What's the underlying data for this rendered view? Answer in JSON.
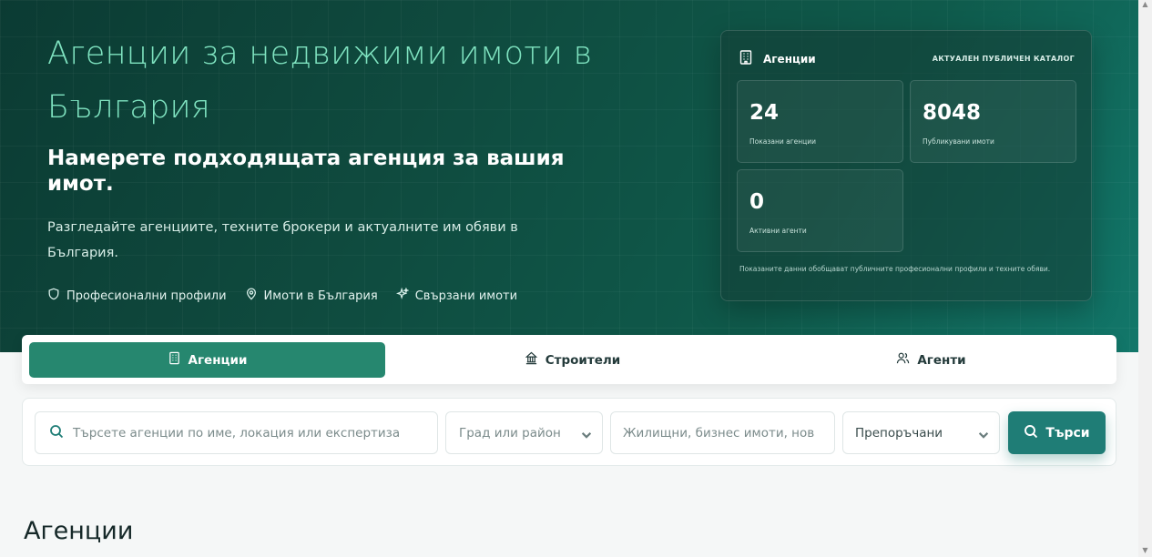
{
  "hero": {
    "title": "Агенции за недвижими имоти в България",
    "subtitle": "Намерете подходящата агенция за вашия имот.",
    "description": "Разгледайте агенциите, техните брокери и актуалните им обяви в България.",
    "features": [
      {
        "icon": "shield-icon",
        "label": "Професионални профили"
      },
      {
        "icon": "location-pin-icon",
        "label": "Имоти в България"
      },
      {
        "icon": "sparkles-icon",
        "label": "Свързани имоти"
      }
    ]
  },
  "stats": {
    "title": "Агенции",
    "catalog": "АКТУАЛЕН ПУБЛИЧЕН КАТАЛОГ",
    "cards": [
      {
        "value": "24",
        "label": "Показани агенции"
      },
      {
        "value": "8048",
        "label": "Публикувани имоти"
      },
      {
        "value": "0",
        "label": "Активни агенти"
      }
    ],
    "note": "Показаните данни обобщават публичните професионални профили и техните обяви."
  },
  "tabs": [
    {
      "label": "Агенции",
      "icon": "building-icon",
      "active": true
    },
    {
      "label": "Строители",
      "icon": "bank-icon",
      "active": false
    },
    {
      "label": "Агенти",
      "icon": "users-icon",
      "active": false
    }
  ],
  "search": {
    "query_placeholder": "Търсете агенции по име, локация или експертиза",
    "city_placeholder": "Град или район",
    "type_placeholder": "Жилищни, бизнес имоти, нов",
    "sort_value": "Препоръчани",
    "button_label": "Търси"
  },
  "section": {
    "title": "Агенции"
  },
  "colors": {
    "accent": "#26876f",
    "hero_title": "#7fe3c0",
    "search_button": "#1f7d76"
  }
}
